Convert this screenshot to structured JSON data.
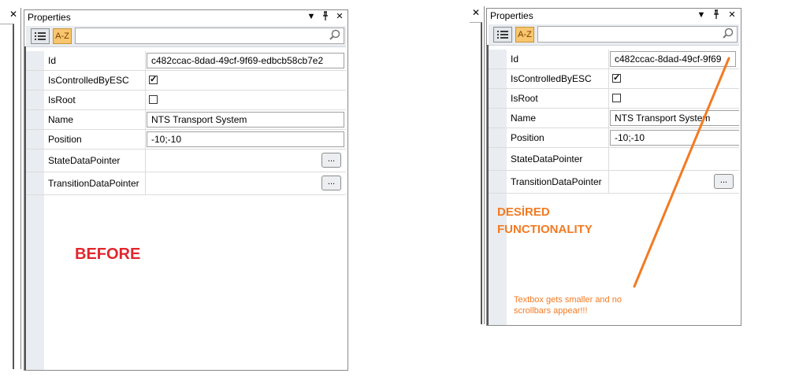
{
  "before": {
    "strip_close": "✕",
    "panel": {
      "title": "Properties",
      "btn_dropdown": "▼",
      "btn_pin": "📌",
      "btn_close": "✕",
      "toolbar": {
        "categorized_label": "⋮☰",
        "az_label": "A-Z",
        "search_value": ""
      },
      "rows": {
        "id": {
          "name": "Id",
          "value": "c482ccac-8dad-49cf-9f69-edbcb58cb7e2"
        },
        "controlled": {
          "name": "IsControlledByESC",
          "checked": true
        },
        "root": {
          "name": "IsRoot",
          "checked": false
        },
        "name": {
          "name": "Name",
          "value": "NTS Transport System"
        },
        "position": {
          "name": "Position",
          "value": "-10;-10"
        },
        "state": {
          "name": "StateDataPointer",
          "button": "..."
        },
        "transition": {
          "name": "TransitionDataPointer",
          "button": "..."
        }
      }
    },
    "label": "BEFORE"
  },
  "after": {
    "strip_close": "✕",
    "panel": {
      "title": "Properties",
      "btn_dropdown": "▼",
      "btn_pin": "📌",
      "btn_close": "✕",
      "toolbar": {
        "categorized_label": "⋮☰",
        "az_label": "A-Z",
        "search_value": ""
      },
      "rows": {
        "id": {
          "name": "Id",
          "value": "c482ccac-8dad-49cf-9f69"
        },
        "controlled": {
          "name": "IsControlledByESC",
          "checked": true
        },
        "root": {
          "name": "IsRoot",
          "checked": false
        },
        "name": {
          "name": "Name",
          "value": "NTS Transport System"
        },
        "position": {
          "name": "Position",
          "value": "-10;-10"
        },
        "state": {
          "name": "StateDataPointer",
          "button": ""
        },
        "transition": {
          "name": "TransitionDataPointer",
          "button": "..."
        }
      }
    },
    "label": "DESİRED FUNCTIONALITY",
    "note": "Textbox gets smaller and no scrollbars appear!!!"
  },
  "colors": {
    "before_label": "#e1262d",
    "annotation": "#f37a22",
    "az_button": "#f8c66e",
    "gutter": "#e9ecf0"
  },
  "icons": [
    "close-icon",
    "dropdown-icon",
    "pin-icon",
    "search-icon",
    "categorized-icon"
  ]
}
